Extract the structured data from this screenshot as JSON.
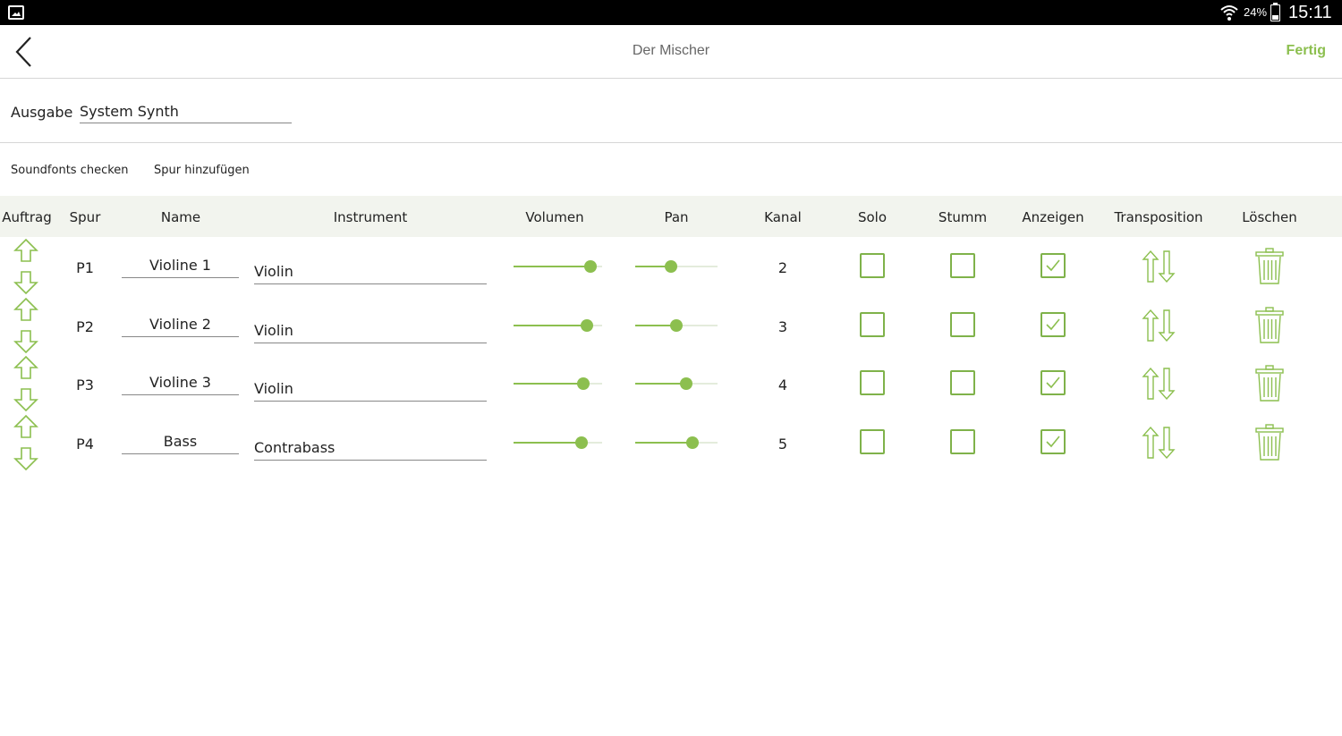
{
  "status_bar": {
    "battery": "24%",
    "time": "15:11"
  },
  "header": {
    "title": "Der Mischer",
    "done_label": "Fertig"
  },
  "output": {
    "label": "Ausgabe",
    "value": "System Synth"
  },
  "actions": {
    "check_soundfonts": "Soundfonts checken",
    "add_track": "Spur hinzufügen"
  },
  "columns": {
    "order": "Auftrag",
    "track": "Spur",
    "name": "Name",
    "instrument": "Instrument",
    "volume": "Volumen",
    "pan": "Pan",
    "channel": "Kanal",
    "solo": "Solo",
    "mute": "Stumm",
    "show": "Anzeigen",
    "transposition": "Transposition",
    "delete": "Löschen"
  },
  "tracks": [
    {
      "id": "P1",
      "name": "Violine 1",
      "instrument": "Violin",
      "volume": 0.93,
      "pan": 0.42,
      "channel": "2",
      "solo": false,
      "mute": false,
      "show": true
    },
    {
      "id": "P2",
      "name": "Violine 2",
      "instrument": "Violin",
      "volume": 0.88,
      "pan": 0.5,
      "channel": "3",
      "solo": false,
      "mute": false,
      "show": true
    },
    {
      "id": "P3",
      "name": "Violine 3",
      "instrument": "Violin",
      "volume": 0.84,
      "pan": 0.64,
      "channel": "4",
      "solo": false,
      "mute": false,
      "show": true
    },
    {
      "id": "P4",
      "name": "Bass",
      "instrument": "Contrabass",
      "volume": 0.81,
      "pan": 0.73,
      "channel": "5",
      "solo": false,
      "mute": false,
      "show": true
    }
  ],
  "colors": {
    "accent": "#8cbf4f",
    "header_bg": "#f2f4ee"
  }
}
